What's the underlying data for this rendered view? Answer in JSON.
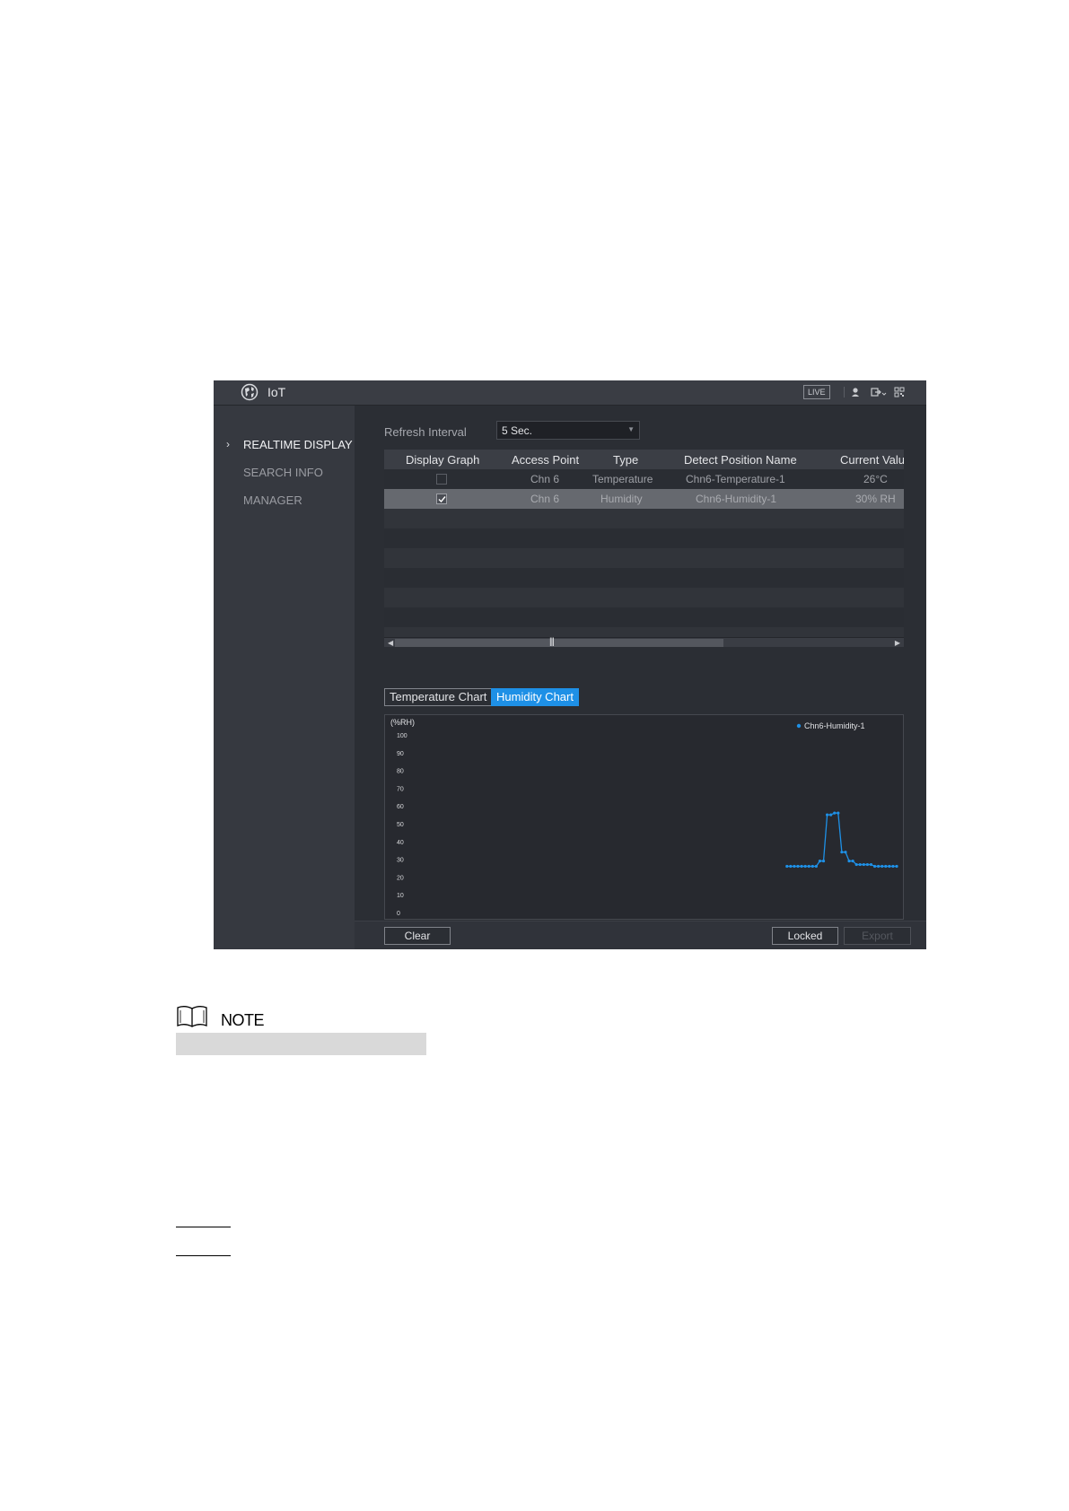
{
  "window": {
    "title": "IoT",
    "live_badge": "LIVE"
  },
  "sidebar": {
    "items": [
      {
        "label": "REALTIME DISPLAY",
        "active": true
      },
      {
        "label": "SEARCH INFO",
        "active": false
      },
      {
        "label": "MANAGER",
        "active": false
      }
    ]
  },
  "refresh": {
    "label": "Refresh Interval",
    "value": "5 Sec."
  },
  "table": {
    "headers": [
      "Display Graph",
      "Access Point",
      "Type",
      "Detect Position Name",
      "Current Valu"
    ],
    "rows": [
      {
        "checked": false,
        "access_point": "Chn 6",
        "type": "Temperature",
        "position": "Chn6-Temperature-1",
        "value": "26°C"
      },
      {
        "checked": true,
        "access_point": "Chn 6",
        "type": "Humidity",
        "position": "Chn6-Humidity-1",
        "value": "30% RH"
      }
    ]
  },
  "tabs": {
    "temperature": "Temperature Chart",
    "humidity": "Humidity Chart"
  },
  "chart_data": {
    "type": "line",
    "ylabel": "(%RH)",
    "ylim": [
      0,
      100
    ],
    "yticks": [
      100,
      90,
      80,
      70,
      60,
      50,
      40,
      30,
      20,
      10,
      0
    ],
    "x": [
      1,
      2,
      3,
      4,
      5,
      6,
      7,
      8,
      9,
      10,
      11,
      12,
      13,
      14,
      15,
      16,
      17,
      18,
      19,
      20,
      21,
      22,
      23,
      24,
      25,
      26,
      27,
      28,
      29,
      30,
      31
    ],
    "xlim": [
      -104,
      31
    ],
    "series": [
      {
        "name": "Chn6-Humidity-1",
        "color": "#1e90e6",
        "values": [
          26,
          26,
          26,
          26,
          26,
          26,
          26,
          26,
          26,
          29,
          29,
          55,
          55,
          56,
          56,
          34,
          34,
          29,
          29,
          27,
          27,
          27,
          27,
          27,
          26,
          26,
          26,
          26,
          26,
          26,
          26
        ]
      }
    ],
    "legend": "top-right",
    "grid": false
  },
  "footer": {
    "clear": "Clear",
    "locked": "Locked",
    "export": "Export"
  },
  "note": {
    "label": "NOTE"
  },
  "colors": {
    "accent": "#1e90e6",
    "window_bg": "#2b2e34",
    "sidebar_bg": "#363940",
    "selected_row": "#66696f"
  }
}
